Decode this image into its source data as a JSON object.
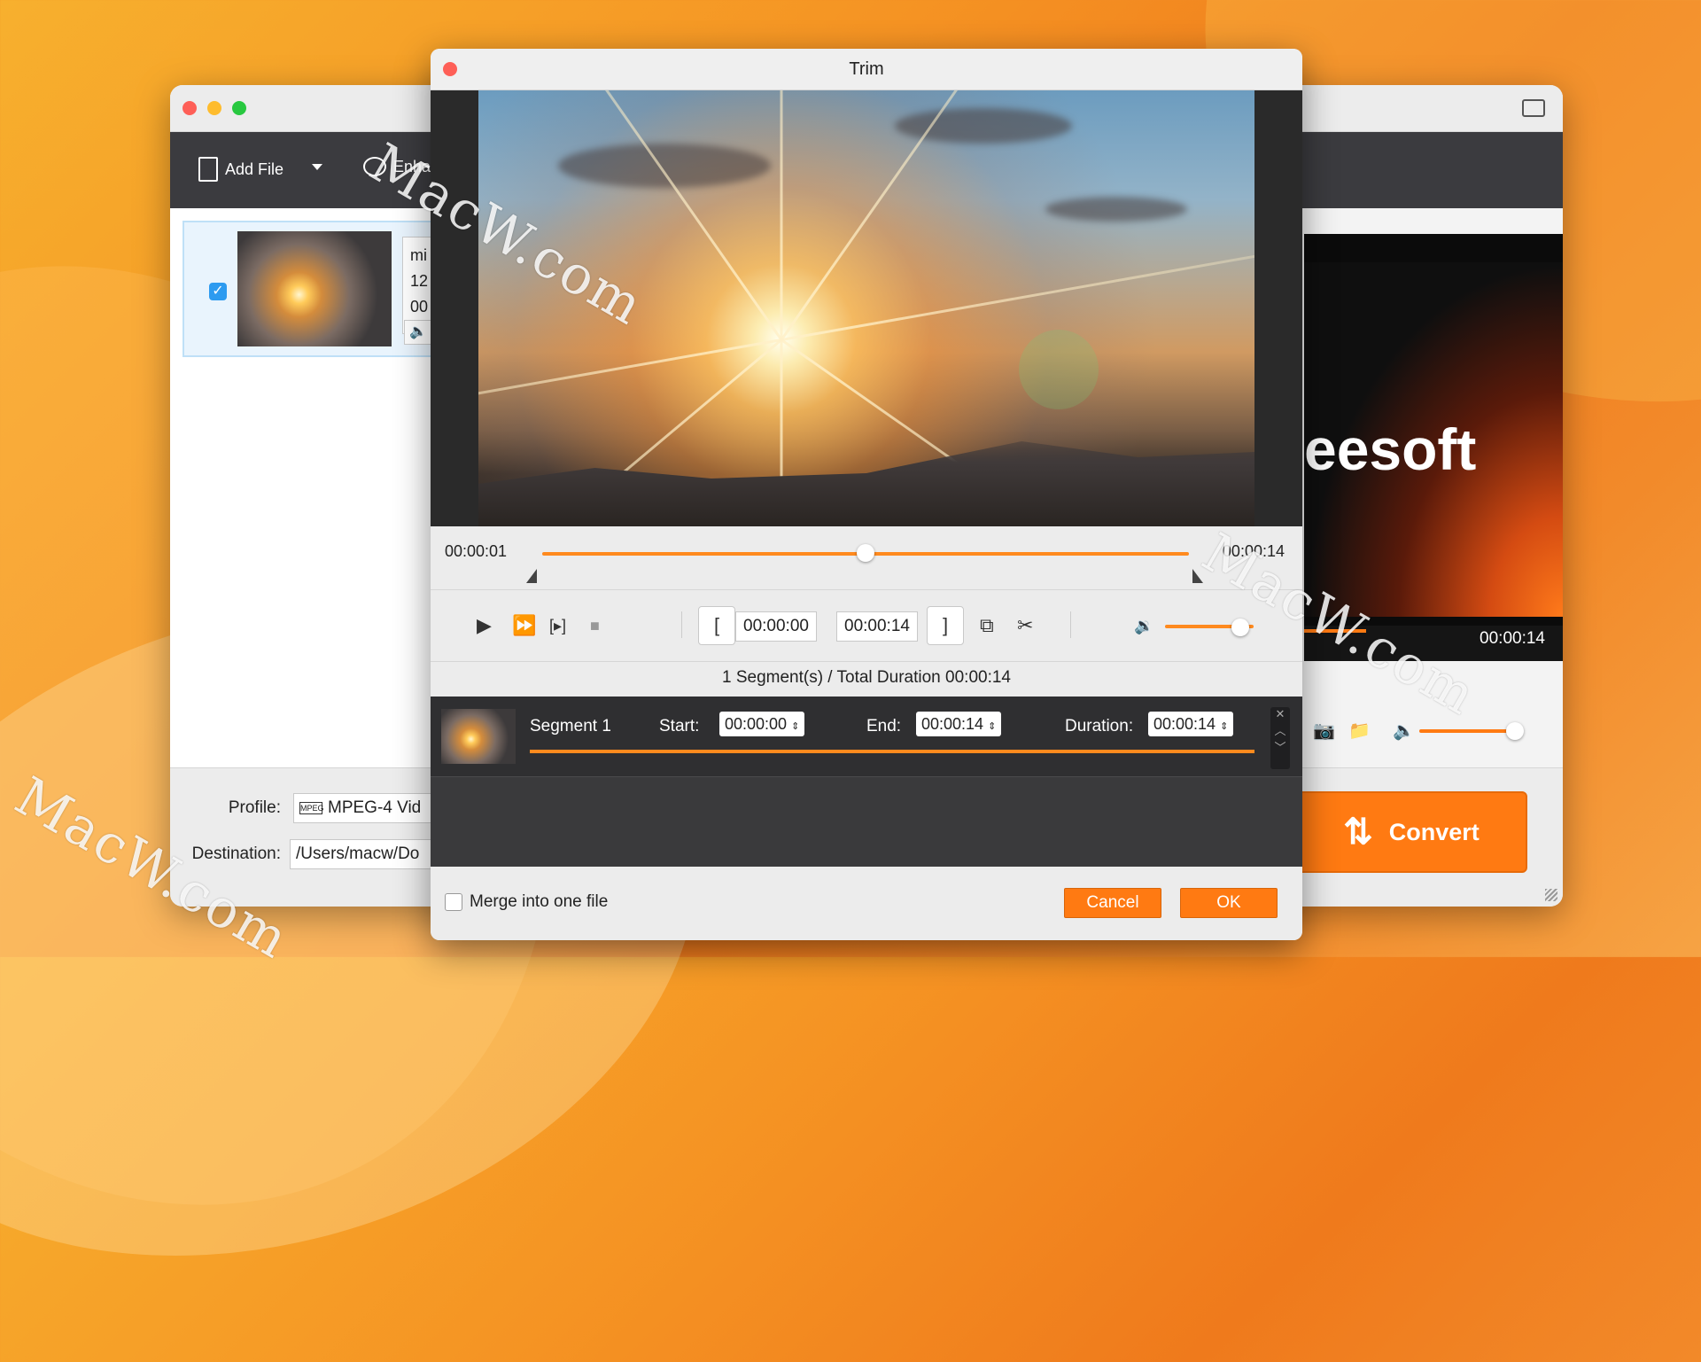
{
  "main_window": {
    "toolbar": {
      "add_file": "Add File",
      "enhance": "Enha"
    },
    "file": {
      "line1": "mi",
      "line2": "12",
      "line3": "00"
    },
    "profile_label": "Profile:",
    "profile_value": "MPEG-4 Vid",
    "profile_icon_text": "MPEG",
    "destination_label": "Destination:",
    "destination_value": "/Users/macw/Do",
    "preview": {
      "brand_text": "eesoft",
      "time": "00:00:14",
      "volume": 0.85
    },
    "convert_label": "Convert"
  },
  "trim": {
    "title": "Trim",
    "time_start": "00:00:01",
    "time_end": "00:00:14",
    "playhead": 0.5,
    "start_value": "00:00:00",
    "end_value": "00:00:14",
    "volume": 0.85,
    "summary": "1 Segment(s) / Total Duration 00:00:14",
    "segment": {
      "name": "Segment 1",
      "start_label": "Start:",
      "start_value": "00:00:00",
      "end_label": "End:",
      "end_value": "00:00:14",
      "duration_label": "Duration:",
      "duration_value": "00:00:14"
    },
    "merge_label": "Merge into one file",
    "cancel_label": "Cancel",
    "ok_label": "OK"
  },
  "watermarks": [
    "MacW.com",
    "MacW.com",
    "MacW.com"
  ],
  "colors": {
    "accent": "#ff7a12",
    "checkbox": "#2d9bf0"
  }
}
